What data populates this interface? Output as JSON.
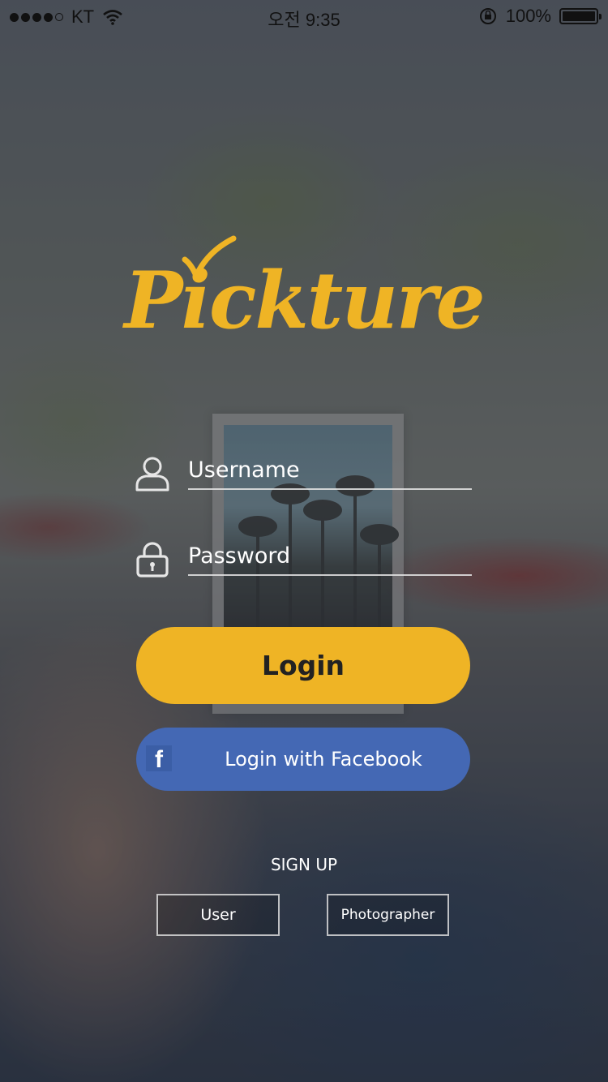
{
  "status_bar": {
    "carrier": "KT",
    "time": "오전 9:35",
    "battery": "100%",
    "signal_bars_filled": 4,
    "signal_bars_total": 5
  },
  "app": {
    "logo_text": "Pickture",
    "brand_color": "#efb425"
  },
  "login_form": {
    "username_placeholder": "Username",
    "password_placeholder": "Password",
    "login_label": "Login",
    "facebook_label": "Login with Facebook",
    "facebook_icon": "f",
    "facebook_color": "#4468b4"
  },
  "signup": {
    "title": "SIGN UP",
    "user_label": "User",
    "photographer_label": "Photographer"
  }
}
